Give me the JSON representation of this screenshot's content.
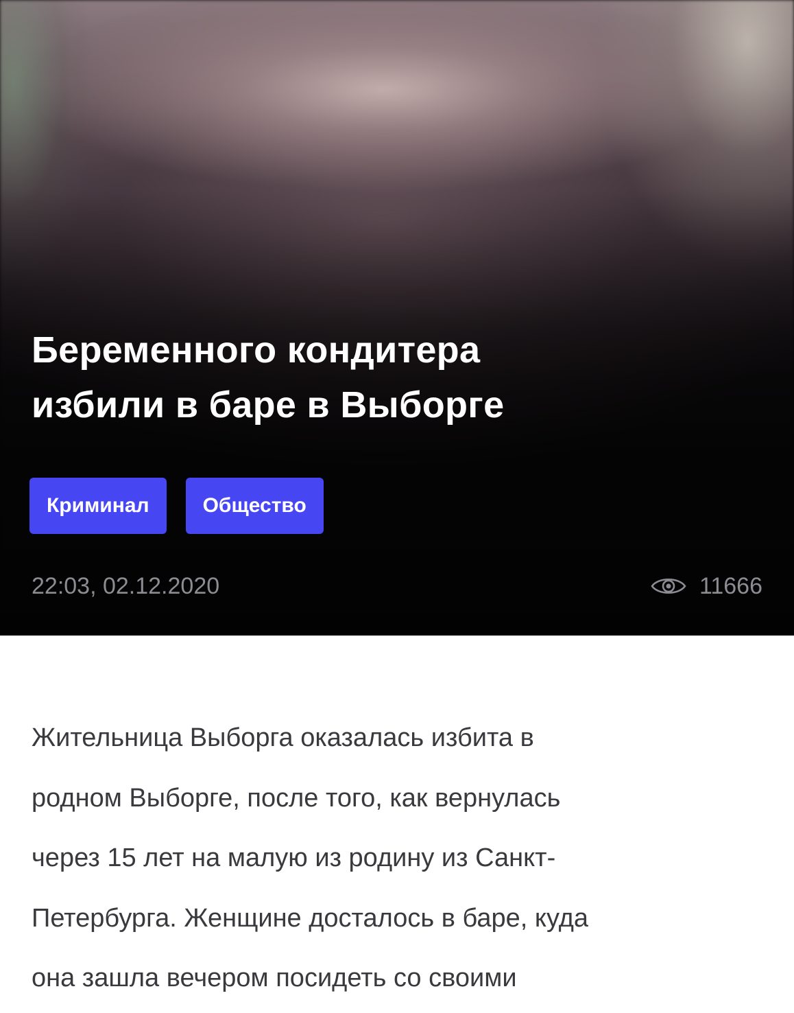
{
  "article": {
    "headline_lines": [
      "Беременного кондитера",
      "избили в баре в Выборге"
    ],
    "tags": [
      {
        "label": "Криминал"
      },
      {
        "label": "Общество"
      }
    ],
    "published": "22:03, 02.12.2020",
    "views": "11666",
    "views_icon": "eye-icon",
    "body_lines": [
      "Жительница Выборга оказалась избита в",
      "родном Выборге, после того, как вернулась",
      "через 15 лет на малую  из родину из Санкт-",
      "Петербурга. Женщине досталось в баре, куда",
      "она зашла вечером посидеть со своими"
    ]
  },
  "colors": {
    "tag_background": "#4746f3",
    "meta_text": "#8d8c92",
    "body_text": "#3a3a3e",
    "hero_background": "#0e0d0f"
  }
}
